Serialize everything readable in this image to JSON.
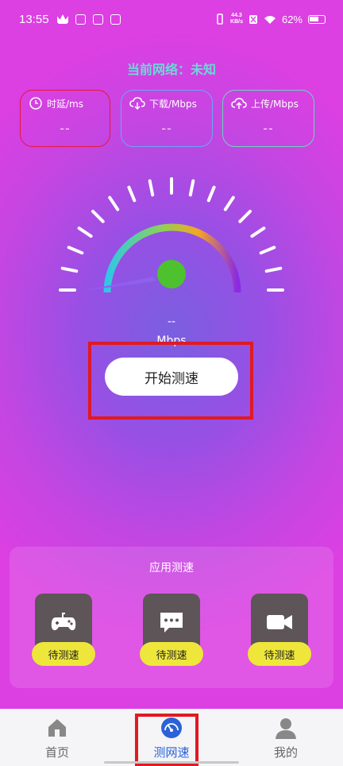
{
  "status_bar": {
    "time": "13:55",
    "net_speed_value": "44.3",
    "net_speed_unit": "KB/s",
    "battery": "62%"
  },
  "network": {
    "label": "当前网络：未知"
  },
  "metrics": [
    {
      "label": "时延/ms",
      "value": "--",
      "icon": "clock-icon",
      "color": "#e8173a"
    },
    {
      "label": "下载/Mbps",
      "value": "--",
      "icon": "cloud-download-icon",
      "color": "#6ca6f7"
    },
    {
      "label": "上传/Mbps",
      "value": "--",
      "icon": "cloud-upload-icon",
      "color": "#69d6c0"
    }
  ],
  "gauge": {
    "value": "--",
    "unit": "Mbps"
  },
  "start_button": {
    "label": "开始测速"
  },
  "apps": {
    "title": "应用测速",
    "items": [
      {
        "icon": "gamepad-icon",
        "label": "待测速"
      },
      {
        "icon": "chat-icon",
        "label": "待测速"
      },
      {
        "icon": "video-camera-icon",
        "label": "待测速"
      }
    ]
  },
  "bottom_nav": {
    "items": [
      {
        "label": "首页",
        "icon": "home-icon",
        "active": false
      },
      {
        "label": "测网速",
        "icon": "speedometer-icon",
        "active": true
      },
      {
        "label": "我的",
        "icon": "person-icon",
        "active": false
      }
    ],
    "active_color": "#2a62d8"
  }
}
